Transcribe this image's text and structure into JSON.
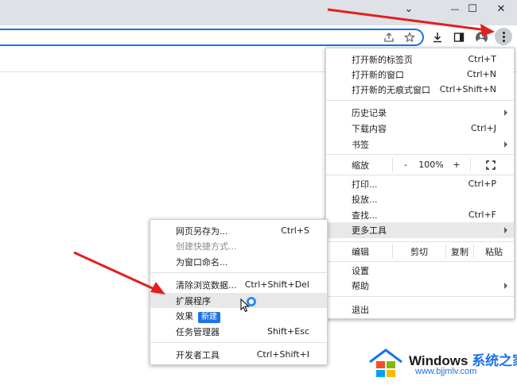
{
  "window": {
    "minimize_glyph": "—",
    "maximize_glyph": "☐",
    "close_glyph": "✕",
    "tab_list_glyph": "⌄"
  },
  "main_menu": {
    "items": [
      {
        "label": "打开新的标签页",
        "shortcut": "Ctrl+T"
      },
      {
        "label": "打开新的窗口",
        "shortcut": "Ctrl+N"
      },
      {
        "label": "打开新的无痕式窗口",
        "shortcut": "Ctrl+Shift+N"
      },
      {
        "label": "历史记录",
        "shortcut": ""
      },
      {
        "label": "下载内容",
        "shortcut": "Ctrl+J"
      },
      {
        "label": "书签",
        "shortcut": ""
      },
      {
        "label": "缩放",
        "shortcut": ""
      },
      {
        "label": "打印...",
        "shortcut": "Ctrl+P"
      },
      {
        "label": "投放...",
        "shortcut": ""
      },
      {
        "label": "查找...",
        "shortcut": "Ctrl+F"
      },
      {
        "label": "更多工具",
        "shortcut": ""
      },
      {
        "label": "编辑",
        "shortcut": ""
      },
      {
        "label": "设置",
        "shortcut": ""
      },
      {
        "label": "帮助",
        "shortcut": ""
      },
      {
        "label": "退出",
        "shortcut": ""
      }
    ],
    "zoom": {
      "minus": "-",
      "value": "100%",
      "plus": "+"
    },
    "edit": {
      "cut": "剪切",
      "copy": "复制",
      "paste": "粘贴"
    }
  },
  "submenu": {
    "items": [
      {
        "label": "网页另存为...",
        "shortcut": "Ctrl+S"
      },
      {
        "label": "创建快捷方式...",
        "shortcut": ""
      },
      {
        "label": "为窗口命名...",
        "shortcut": ""
      },
      {
        "label": "清除浏览数据...",
        "shortcut": "Ctrl+Shift+Del"
      },
      {
        "label": "扩展程序",
        "shortcut": ""
      },
      {
        "label": "效果",
        "shortcut": ""
      },
      {
        "label": "任务管理器",
        "shortcut": "Shift+Esc"
      },
      {
        "label": "开发者工具",
        "shortcut": "Ctrl+Shift+I"
      }
    ],
    "new_badge": "新建"
  },
  "watermark": {
    "brand": "Windows",
    "brand_cn": "系统之家",
    "url": "www.bjjmlv.com"
  },
  "colors": {
    "accent": "#1a73e8",
    "arrow": "#e02020"
  }
}
